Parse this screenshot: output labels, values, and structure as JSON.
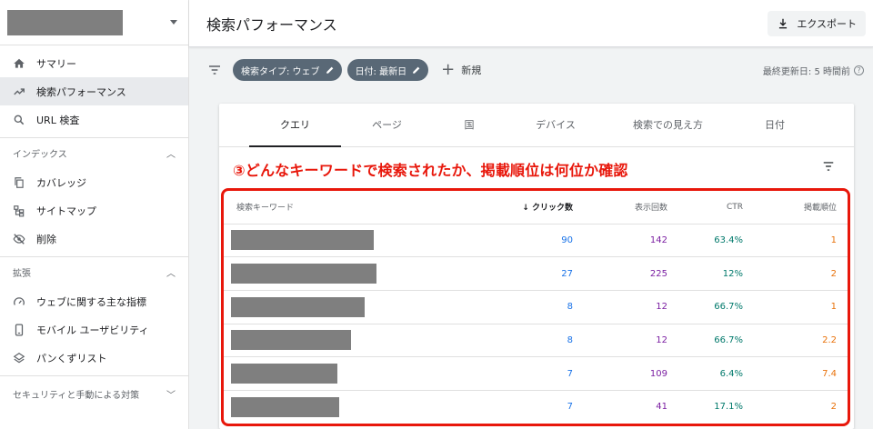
{
  "sidebar": {
    "items_top": [
      {
        "label": "サマリー",
        "icon": "home-icon"
      },
      {
        "label": "検索パフォーマンス",
        "icon": "trending-icon",
        "active": true
      },
      {
        "label": "URL 検査",
        "icon": "search-icon"
      }
    ],
    "section_index": {
      "title": "インデックス",
      "items": [
        {
          "label": "カバレッジ",
          "icon": "copy-icon"
        },
        {
          "label": "サイトマップ",
          "icon": "sitemap-icon"
        },
        {
          "label": "削除",
          "icon": "eye-off-icon"
        }
      ]
    },
    "section_ext": {
      "title": "拡張",
      "items": [
        {
          "label": "ウェブに関する主な指標",
          "icon": "speed-icon"
        },
        {
          "label": "モバイル ユーザビリティ",
          "icon": "phone-icon"
        },
        {
          "label": "パンくずリスト",
          "icon": "layers-icon"
        }
      ]
    },
    "section_security": {
      "title": "セキュリティと手動による対策"
    }
  },
  "header": {
    "title": "検索パフォーマンス",
    "export_label": "エクスポート"
  },
  "filters": {
    "chip_type": "検索タイプ: ウェブ",
    "chip_date": "日付: 最新日",
    "new_label": "新規",
    "updated": "最終更新日: 5 時間前"
  },
  "tabs": [
    "クエリ",
    "ページ",
    "国",
    "デバイス",
    "検索での見え方",
    "日付"
  ],
  "annotation": "③どんなキーワードで検索されたか、掲載順位は何位か確認",
  "table": {
    "headers": {
      "keyword": "検索キーワード",
      "clicks": "クリック数",
      "impressions": "表示回数",
      "ctr": "CTR",
      "position": "掲載順位"
    },
    "rows": [
      {
        "clicks": "90",
        "impressions": "142",
        "ctr": "63.4%",
        "position": "1"
      },
      {
        "clicks": "27",
        "impressions": "225",
        "ctr": "12%",
        "position": "2"
      },
      {
        "clicks": "8",
        "impressions": "12",
        "ctr": "66.7%",
        "position": "1"
      },
      {
        "clicks": "8",
        "impressions": "12",
        "ctr": "66.7%",
        "position": "2.2"
      },
      {
        "clicks": "7",
        "impressions": "109",
        "ctr": "6.4%",
        "position": "7.4"
      },
      {
        "clicks": "7",
        "impressions": "41",
        "ctr": "17.1%",
        "position": "2"
      }
    ]
  },
  "colors": {
    "clicks": "#1a73e8",
    "impressions": "#7b1fa2",
    "ctr": "#00796b",
    "position": "#e8710a",
    "annotation": "#e8170b"
  }
}
